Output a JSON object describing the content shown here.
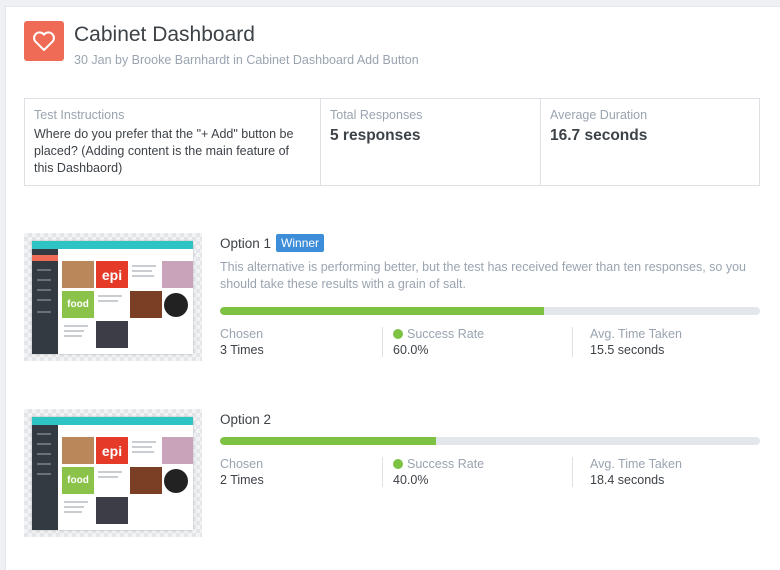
{
  "header": {
    "title": "Cabinet Dashboard",
    "subtitle": "30 Jan by Brooke Barnhardt in Cabinet Dashboard Add Button",
    "icon": "heart-icon",
    "accent_color": "#ef6b55"
  },
  "stats": {
    "instructions_label": "Test Instructions",
    "instructions_text": "Where do you prefer that the \"+ Add\" button be placed? (Adding content is the main feature of this Dashbaord)",
    "responses_label": "Total Responses",
    "responses_value": "5 responses",
    "duration_label": "Average Duration",
    "duration_value": "16.7 seconds"
  },
  "options": [
    {
      "title": "Option 1",
      "badge": "Winner",
      "description": "This alternative is performing better, but the test has received fewer than ten responses, so you should take these results with a grain of salt.",
      "success_fraction": 0.6,
      "chosen_label": "Chosen",
      "chosen_value": "3 Times",
      "success_label": "Success Rate",
      "success_value": "60.0%",
      "time_label": "Avg. Time Taken",
      "time_value": "15.5 seconds",
      "thumb": {
        "epi": "epi",
        "food": "food"
      }
    },
    {
      "title": "Option 2",
      "success_fraction": 0.4,
      "chosen_label": "Chosen",
      "chosen_value": "2 Times",
      "success_label": "Success Rate",
      "success_value": "40.0%",
      "time_label": "Avg. Time Taken",
      "time_value": "18.4 seconds",
      "thumb": {
        "epi": "epi",
        "food": "food"
      }
    }
  ],
  "colors": {
    "success": "#7dc242",
    "badge": "#3e8dd8",
    "bar_track": "#e3e6ea"
  }
}
